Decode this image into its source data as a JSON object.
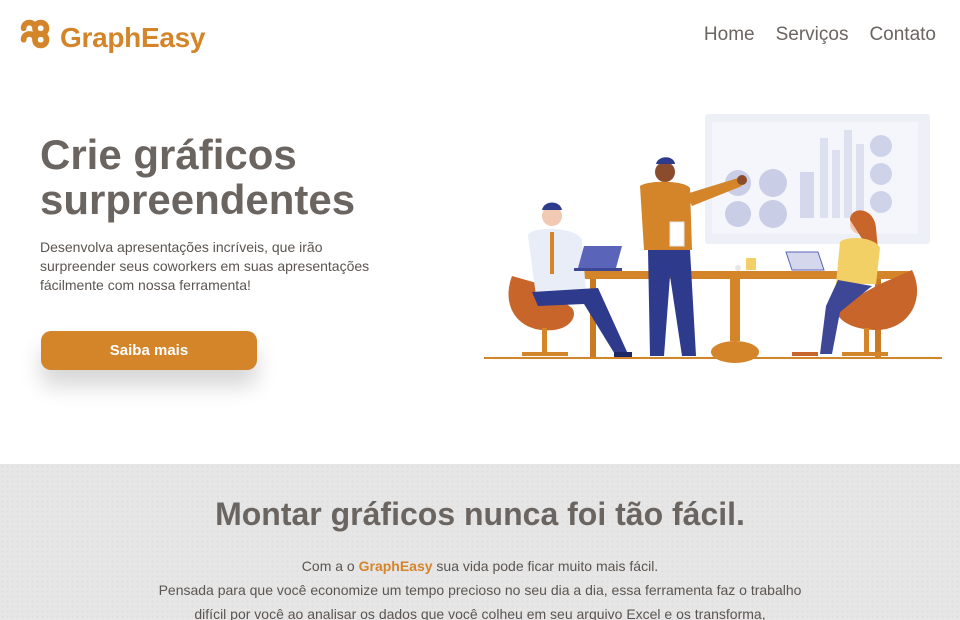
{
  "brand": {
    "name": "GraphEasy",
    "color": "#d4852a"
  },
  "nav": {
    "items": [
      {
        "label": "Home"
      },
      {
        "label": "Serviços"
      },
      {
        "label": "Contato"
      }
    ]
  },
  "hero": {
    "title_line1": "Crie gráficos",
    "title_line2": "surpreendentes",
    "subtitle": "Desenvolva apresentações incríveis, que irão surpreender seus coworkers em suas apresentações fácilmente com nossa ferramenta!",
    "cta_label": "Saiba mais",
    "illustration_icon": "team-meeting-illustration"
  },
  "section": {
    "title": "Montar gráficos nunca foi tão fácil.",
    "text_prefix": "Com a o ",
    "text_brand": "GraphEasy",
    "text_suffix": " sua vida pode ficar muito mais fácil.",
    "text_line2": "Pensada para que você economize um tempo precioso no seu dia a dia, essa ferramenta faz o trabalho difícil por você ao analisar os dados que você colheu em seu arquivo Excel e os transforma,"
  },
  "colors": {
    "accent": "#d4852a",
    "text": "#6b6561",
    "section_bg": "#e6e6e6"
  }
}
